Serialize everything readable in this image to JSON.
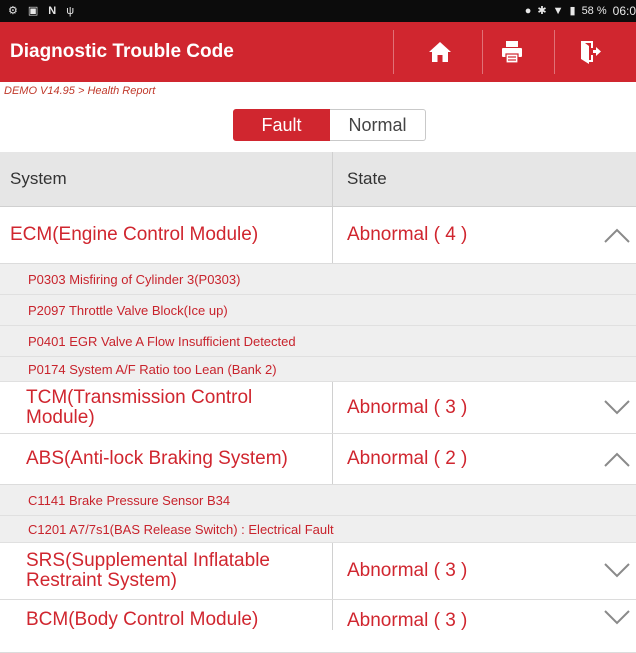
{
  "status_bar": {
    "left_icons": [
      "usb-debug-icon",
      "image-icon",
      "n-icon",
      "usb-icon"
    ],
    "battery": "58 %",
    "time": "06:0"
  },
  "app": {
    "title": "Diagnostic Trouble Code",
    "accent_color": "#d0262f"
  },
  "breadcrumb": "DEMO V14.95 > Health Report",
  "toggle": {
    "fault_label": "Fault",
    "normal_label": "Normal",
    "selected": "Fault"
  },
  "table": {
    "headers": {
      "system": "System",
      "state": "State"
    },
    "systems": [
      {
        "name": "ECM(Engine Control Module)",
        "state": "Abnormal ( 4 )",
        "expanded": true,
        "faults": [
          "P0303 Misfiring of Cylinder 3(P0303)",
          "P2097 Throttle Valve Block(Ice up)",
          "P0401 EGR Valve A Flow Insufficient Detected",
          "P0174 System A/F Ratio too Lean (Bank 2)"
        ]
      },
      {
        "name": "TCM(Transmission Control Module)",
        "state": "Abnormal ( 3 )",
        "expanded": false,
        "faults": []
      },
      {
        "name": "ABS(Anti-lock Braking System)",
        "state": "Abnormal ( 2 )",
        "expanded": true,
        "faults": [
          "C1141 Brake Pressure Sensor B34",
          "C1201 A7/7s1(BAS Release Switch) : Electrical Fault"
        ]
      },
      {
        "name": "SRS(Supplemental Inflatable Restraint System)",
        "state": "Abnormal ( 3 )",
        "expanded": false,
        "faults": []
      },
      {
        "name": "BCM(Body Control Module)",
        "state": "Abnormal ( 3 )",
        "expanded": false,
        "faults": []
      }
    ]
  }
}
